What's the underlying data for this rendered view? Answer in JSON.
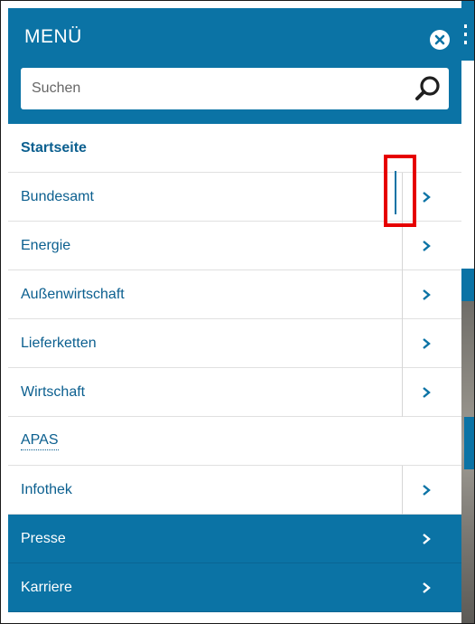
{
  "menu": {
    "title": "MENÜ",
    "close_icon": "close-icon",
    "search": {
      "placeholder": "Suchen",
      "icon": "search-icon"
    }
  },
  "items": [
    {
      "label": "Startseite",
      "has_submenu": false
    },
    {
      "label": "Bundesamt",
      "has_submenu": true
    },
    {
      "label": "Energie",
      "has_submenu": true
    },
    {
      "label": "Außenwirtschaft",
      "has_submenu": true
    },
    {
      "label": "Lieferketten",
      "has_submenu": true
    },
    {
      "label": "Wirtschaft",
      "has_submenu": true
    },
    {
      "label": "APAS",
      "has_submenu": false
    },
    {
      "label": "Infothek",
      "has_submenu": true
    },
    {
      "label": "Presse",
      "has_submenu": true
    },
    {
      "label": "Karriere",
      "has_submenu": true
    }
  ],
  "colors": {
    "brand_blue": "#0b73a5",
    "link_blue": "#0b5f8f",
    "highlight_red": "#e60000"
  }
}
